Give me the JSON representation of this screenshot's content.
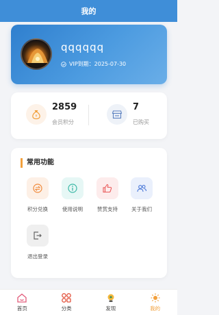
{
  "header": {
    "title": "我的"
  },
  "profile": {
    "username": "qqqqqq",
    "vip_text": "VIP到期：2025-07-30"
  },
  "stats": [
    {
      "value": "2859",
      "label": "会员积分",
      "icon": "money-bag-icon"
    },
    {
      "value": "7",
      "label": "已购买",
      "icon": "store-icon"
    }
  ],
  "functions": {
    "title": "常用功能",
    "items": [
      {
        "label": "积分兑换",
        "icon": "exchange-icon",
        "bg": "#fdf0e6",
        "color": "#f08a3c"
      },
      {
        "label": "使用说明",
        "icon": "info-icon",
        "bg": "#e6f7f5",
        "color": "#3cb8a6"
      },
      {
        "label": "赞赏支持",
        "icon": "thumbs-up-icon",
        "bg": "#fdecec",
        "color": "#ea5a5a"
      },
      {
        "label": "关于我们",
        "icon": "users-icon",
        "bg": "#eaf0fc",
        "color": "#4a78d8"
      },
      {
        "label": "退出登录",
        "icon": "logout-icon",
        "bg": "#efefef",
        "color": "#666666"
      }
    ]
  },
  "tabbar": [
    {
      "label": "首页",
      "icon": "home-icon"
    },
    {
      "label": "分类",
      "icon": "category-icon"
    },
    {
      "label": "发现",
      "icon": "discover-icon"
    },
    {
      "label": "我的",
      "icon": "profile-icon",
      "active": true
    }
  ],
  "colors": {
    "primary": "#3f8ed8",
    "accent": "#f2a03c"
  }
}
